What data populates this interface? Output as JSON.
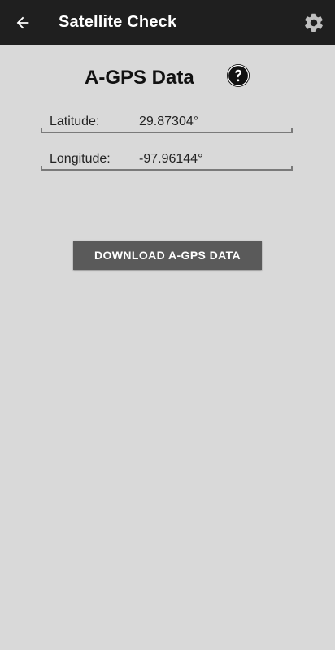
{
  "app_bar": {
    "title": "Satellite Check",
    "back_icon": "arrow-left-icon",
    "settings_icon": "gear-icon",
    "background": "#1f1f1f",
    "text_color": "#ffffff"
  },
  "main": {
    "heading": "A-GPS Data",
    "help_icon": "question-circle-icon",
    "background": "#d9d9d9",
    "fields": [
      {
        "label": "Latitude:",
        "value": "29.87304°"
      },
      {
        "label": "Longitude:",
        "value": "-97.96144°"
      }
    ],
    "download_button": {
      "label": "DOWNLOAD A-GPS DATA",
      "color": "#5a5a5a"
    }
  }
}
